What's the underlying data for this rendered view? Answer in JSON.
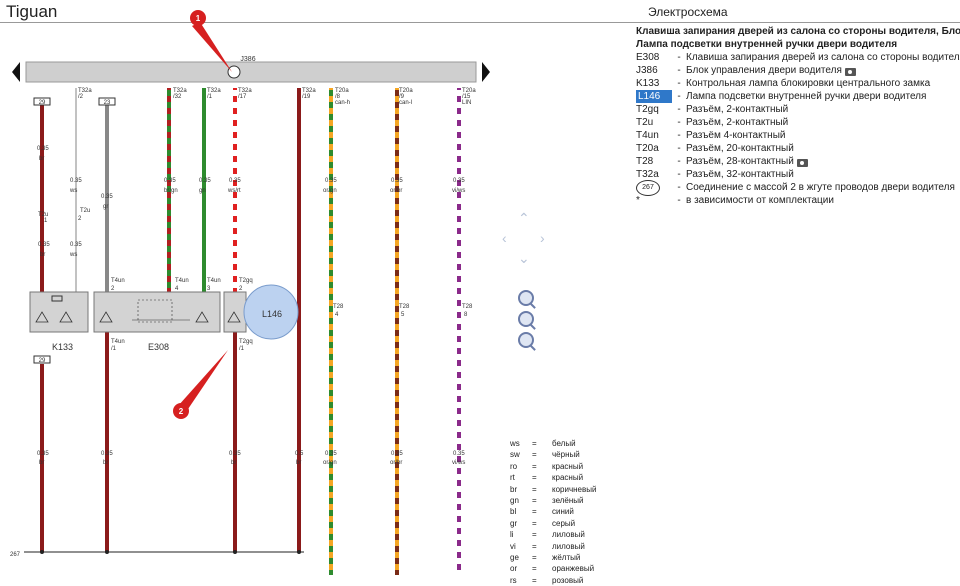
{
  "header": {
    "title": "Tiguan",
    "subtitle": "Электросхема"
  },
  "legend": {
    "heading": [
      "Клавиша запирания дверей из салона со стороны водителя, Блок у",
      "Лампа подсветки внутренней ручки двери водителя"
    ],
    "items": [
      {
        "code": "E308",
        "text": "Клавиша запирания дверей из салона со стороны водителя",
        "selected": false,
        "camera": false
      },
      {
        "code": "J386",
        "text": "Блок управления двери водителя",
        "selected": false,
        "camera": true
      },
      {
        "code": "K133",
        "text": "Контрольная лампа блокировки центрального замка",
        "selected": false,
        "camera": false
      },
      {
        "code": "L146",
        "text": "Лампа подсветки внутренней ручки двери водителя",
        "selected": true,
        "camera": false
      },
      {
        "code": "T2gq",
        "text": "Разъём, 2-контактный",
        "selected": false,
        "camera": false
      },
      {
        "code": "T2u",
        "text": "Разъём, 2-контактный",
        "selected": false,
        "camera": false
      },
      {
        "code": "T4un",
        "text": "Разъём 4-контактный",
        "selected": false,
        "camera": false
      },
      {
        "code": "T20a",
        "text": "Разъём, 20-контактный",
        "selected": false,
        "camera": false
      },
      {
        "code": "T28",
        "text": "Разъём, 28-контактный",
        "selected": false,
        "camera": true
      },
      {
        "code": "T32a",
        "text": "Разъём, 32-контактный",
        "selected": false,
        "camera": false
      }
    ],
    "ground": {
      "code": "267",
      "text": "Соединение с массой 2 в жгуте проводов двери водителя"
    },
    "note": {
      "code": "*",
      "text": "в зависимости от комплектации"
    }
  },
  "color_codes": [
    [
      "ws",
      "=",
      "белый"
    ],
    [
      "sw",
      "=",
      "чёрный"
    ],
    [
      "ro",
      "=",
      "красный"
    ],
    [
      "rt",
      "=",
      "красный"
    ],
    [
      "br",
      "=",
      "коричневый"
    ],
    [
      "gn",
      "=",
      "зелёный"
    ],
    [
      "bl",
      "=",
      "синий"
    ],
    [
      "gr",
      "=",
      "серый"
    ],
    [
      "li",
      "=",
      "лиловый"
    ],
    [
      "vi",
      "=",
      "лиловый"
    ],
    [
      "ge",
      "=",
      "жёлтый"
    ],
    [
      "or",
      "=",
      "оранжевый"
    ],
    [
      "rs",
      "=",
      "розовый"
    ]
  ],
  "diagram": {
    "bus_label": "J386",
    "callouts": [
      "1",
      "2"
    ],
    "components": [
      "K133",
      "E308",
      "L146"
    ],
    "ground_label": "267",
    "wires": [
      {
        "top_box": "29",
        "gauge": "0.35",
        "color_text": "br",
        "connector": "T2u",
        "pin": "1",
        "bottom_box": "29",
        "bottom_gauge": "0.35",
        "bottom_color": "br"
      },
      {
        "conn": "T32a",
        "pin": "/2",
        "gauge": "0.35",
        "color_text": "ws",
        "connector": "T2u",
        "pin2": "2"
      },
      {
        "top_box": "23",
        "gauge": "0.35",
        "color_text": "gr",
        "connector": "T4un",
        "pin": "2",
        "bottom_conn": "T4un",
        "bottom_pin": "/1",
        "bottom_gauge": "0.35",
        "bottom_color": "br"
      },
      {
        "conn": "T32a",
        "pin": "/32",
        "gauge": "0.35",
        "color_text": "br/gn",
        "connector": "T4un",
        "pin2": "4"
      },
      {
        "conn": "T32a",
        "pin": "/1",
        "gauge": "0.35",
        "color_text": "gn",
        "connector": "T4un",
        "pin2": "3"
      },
      {
        "conn": "T32a",
        "pin": "/17",
        "gauge": "0.35",
        "color_text": "ws/rt",
        "connector": "T2gq",
        "pin2": "2",
        "bottom_conn": "T2gq",
        "bottom_pin": "/1",
        "bottom_gauge": "0.35",
        "bottom_color": "br"
      },
      {
        "conn": "T32a",
        "pin": "/19",
        "bottom_gauge": "0.5",
        "bottom_color": "br"
      },
      {
        "conn": "T20a",
        "pin": "/8",
        "signal": "can-h",
        "gauge": "0.35",
        "color_text": "or/gn",
        "connector": "T28",
        "pin2": "4",
        "bottom_gauge": "0.35",
        "bottom_color": "or/gn"
      },
      {
        "conn": "T20a",
        "pin": "/9",
        "signal": "can-l",
        "gauge": "0.35",
        "color_text": "or/br",
        "connector": "T28",
        "pin2": "5",
        "bottom_gauge": "0.35",
        "bottom_color": "or/br"
      },
      {
        "conn": "T20a",
        "pin": "/15",
        "signal": "LIN",
        "gauge": "0.35",
        "color_text": "vi/ws",
        "connector": "T28",
        "pin2": "8",
        "bottom_gauge": "0.35",
        "bottom_color": "vi/ws"
      }
    ]
  }
}
